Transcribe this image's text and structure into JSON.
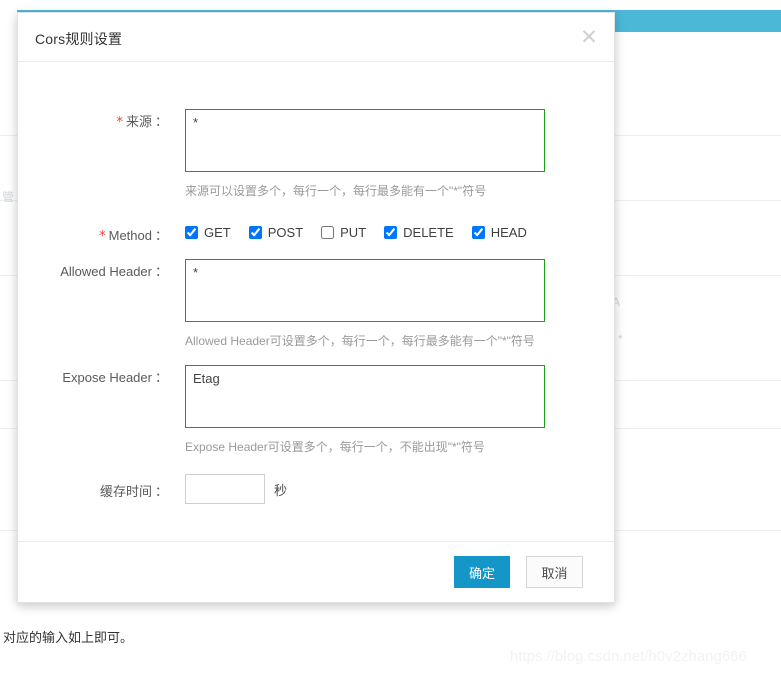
{
  "background": {
    "topbar_color": "#4cb8d8",
    "faint_labels": [
      "管",
      "A",
      "*"
    ]
  },
  "dialog": {
    "title": "Cors规则设置",
    "close_icon": "close-icon",
    "close_glyph": "✕",
    "fields": {
      "origin": {
        "label": "来源",
        "required": true,
        "required_mark": "*",
        "colon": "：",
        "value": "*",
        "placeholder": "",
        "help": "来源可以设置多个，每行一个，每行最多能有一个\"*\"符号"
      },
      "method": {
        "label": "Method",
        "required": true,
        "required_mark": "*",
        "colon": "：",
        "options": [
          {
            "label": "GET",
            "checked": true
          },
          {
            "label": "POST",
            "checked": true
          },
          {
            "label": "PUT",
            "checked": false
          },
          {
            "label": "DELETE",
            "checked": true
          },
          {
            "label": "HEAD",
            "checked": true
          }
        ]
      },
      "allowed_header": {
        "label": "Allowed Header",
        "required": false,
        "colon": "：",
        "value": "*",
        "placeholder": "",
        "help": "Allowed Header可设置多个，每行一个，每行最多能有一个\"*\"符号"
      },
      "expose_header": {
        "label": "Expose Header",
        "required": false,
        "colon": "：",
        "value": "Etag",
        "placeholder": "",
        "help": "Expose Header可设置多个，每行一个，不能出现\"*\"符号"
      },
      "cache_time": {
        "label": "缓存时间",
        "required": false,
        "colon": "：",
        "value": "",
        "placeholder": "",
        "unit": "秒"
      }
    },
    "footer": {
      "confirm_label": "确定",
      "cancel_label": "取消",
      "confirm_color": "#1596c8"
    }
  },
  "caption": "对应的输入如上即可。",
  "watermark": "https://blog.csdn.net/h0v2zhang666"
}
